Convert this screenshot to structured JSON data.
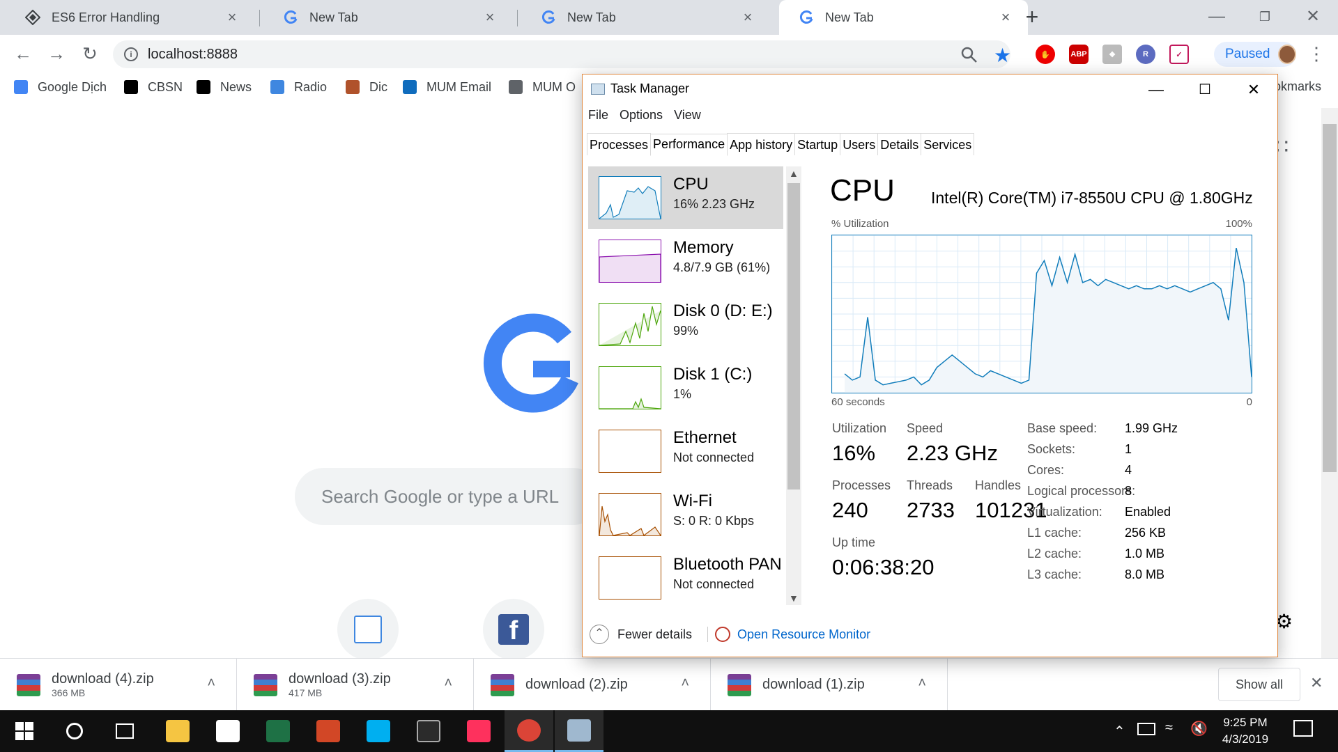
{
  "browser": {
    "tabs": [
      {
        "title": "ES6 Error Handling",
        "icon": "code-diamond-icon",
        "active": false
      },
      {
        "title": "New Tab",
        "icon": "google-icon",
        "active": false
      },
      {
        "title": "New Tab",
        "icon": "google-icon",
        "active": false
      },
      {
        "title": "New Tab",
        "icon": "google-icon",
        "active": true
      }
    ],
    "new_tab_symbol": "+",
    "url": "localhost:8888",
    "profile_label": "Paused",
    "bookmarks": [
      {
        "label": "Google Dịch",
        "icon": "google-translate-icon",
        "color": "#4285f4"
      },
      {
        "label": "CBSN",
        "icon": "cbs-eye-icon",
        "color": "#000000"
      },
      {
        "label": "News",
        "icon": "bold-b-icon",
        "color": "#000000"
      },
      {
        "label": "Radio",
        "icon": "s-letter-icon",
        "color": "#3f87e0"
      },
      {
        "label": "Dic",
        "icon": "cambridge-shield-icon",
        "color": "#b0522b"
      },
      {
        "label": "MUM Email",
        "icon": "outlook-icon",
        "color": "#0f6cbd"
      },
      {
        "label": "MUM O",
        "icon": "document-icon",
        "color": "#5f6368"
      }
    ],
    "bookmarks_overflow": "okmarks",
    "search_placeholder": "Search Google or type a URL",
    "downloads": [
      {
        "name": "download (4).zip",
        "size": "366 MB"
      },
      {
        "name": "download (3).zip",
        "size": "417 MB"
      },
      {
        "name": "download (2).zip",
        "size": ""
      },
      {
        "name": "download (1).zip",
        "size": ""
      }
    ],
    "show_all": "Show all"
  },
  "task_manager": {
    "title": "Task Manager",
    "menu": [
      "File",
      "Options",
      "View"
    ],
    "tabs": [
      "Processes",
      "Performance",
      "App history",
      "Startup",
      "Users",
      "Details",
      "Services"
    ],
    "selected_tab": "Performance",
    "resources": [
      {
        "name": "CPU",
        "sub": "16%  2.23 GHz",
        "color": "#117dbb",
        "selected": true
      },
      {
        "name": "Memory",
        "sub": "4.8/7.9 GB (61%)",
        "color": "#8b12ae",
        "selected": false
      },
      {
        "name": "Disk 0 (D: E:)",
        "sub": "99%",
        "color": "#4da60c",
        "selected": false
      },
      {
        "name": "Disk 1 (C:)",
        "sub": "1%",
        "color": "#4da60c",
        "selected": false
      },
      {
        "name": "Ethernet",
        "sub": "Not connected",
        "color": "#a74f01",
        "selected": false
      },
      {
        "name": "Wi-Fi",
        "sub": "S: 0  R: 0 Kbps",
        "color": "#a74f01",
        "selected": false
      },
      {
        "name": "Bluetooth PAN",
        "sub": "Not connected",
        "color": "#a74f01",
        "selected": false
      }
    ],
    "detail": {
      "title": "CPU",
      "model": "Intel(R) Core(TM) i7-8550U CPU @ 1.80GHz",
      "graph_top_left": "% Utilization",
      "graph_top_right": "100%",
      "graph_bottom_left": "60 seconds",
      "graph_bottom_right": "0",
      "utilization_percent": [
        12,
        8,
        10,
        48,
        8,
        5,
        6,
        7,
        8,
        10,
        5,
        8,
        16,
        20,
        24,
        20,
        16,
        12,
        10,
        14,
        12,
        10,
        8,
        6,
        8,
        76,
        84,
        68,
        86,
        70,
        88,
        70,
        72,
        68,
        72,
        70,
        68,
        66,
        68,
        66,
        66,
        68,
        66,
        68,
        66,
        64,
        66,
        68,
        70,
        66,
        46,
        92,
        70,
        10
      ],
      "stats": [
        {
          "label": "Utilization",
          "value": "16%"
        },
        {
          "label": "Speed",
          "value": "2.23 GHz"
        },
        {
          "label": "Processes",
          "value": "240"
        },
        {
          "label": "Threads",
          "value": "2733"
        },
        {
          "label": "Handles",
          "value": "101231"
        },
        {
          "label": "Up time",
          "value": "0:06:38:20"
        }
      ],
      "specs": [
        {
          "label": "Base speed:",
          "value": "1.99 GHz"
        },
        {
          "label": "Sockets:",
          "value": "1"
        },
        {
          "label": "Cores:",
          "value": "4"
        },
        {
          "label": "Logical processors:",
          "value": "8"
        },
        {
          "label": "Virtualization:",
          "value": "Enabled"
        },
        {
          "label": "L1 cache:",
          "value": "256 KB"
        },
        {
          "label": "L2 cache:",
          "value": "1.0 MB"
        },
        {
          "label": "L3 cache:",
          "value": "8.0 MB"
        }
      ]
    },
    "footer": {
      "fewer_details": "Fewer details",
      "resource_monitor": "Open Resource Monitor"
    }
  },
  "taskbar": {
    "apps": [
      {
        "icon": "file-explorer-icon",
        "color": "#f5c542"
      },
      {
        "icon": "mail-icon",
        "color": "#ffffff"
      },
      {
        "icon": "excel-icon",
        "color": "#1e7145"
      },
      {
        "icon": "powerpoint-icon",
        "color": "#d24726"
      },
      {
        "icon": "skype-icon",
        "color": "#00aff0"
      },
      {
        "icon": "terminal-icon",
        "color": "#2b2b2b"
      },
      {
        "icon": "intellij-icon",
        "color": "#fe315d"
      },
      {
        "icon": "chrome-icon",
        "color": "#db4437"
      },
      {
        "icon": "task-manager-icon",
        "color": "#9fb8cf"
      }
    ],
    "time": "9:25 PM",
    "date": "4/3/2019"
  }
}
